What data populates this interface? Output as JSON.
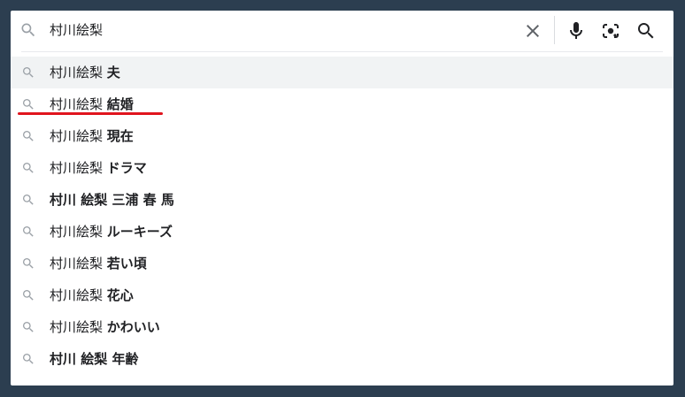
{
  "search": {
    "query": "村川絵梨",
    "icon": "search-icon"
  },
  "controls": {
    "clear_icon": "close-icon",
    "voice_icon": "microphone-icon",
    "lens_icon": "camera-lens-icon",
    "search_icon": "search-icon"
  },
  "suggestions": [
    {
      "prefix": "村川絵梨 ",
      "suffix": "夫"
    },
    {
      "prefix": "村川絵梨 ",
      "suffix": "結婚"
    },
    {
      "prefix": "村川絵梨 ",
      "suffix": "現在"
    },
    {
      "prefix": "村川絵梨 ",
      "suffix": "ドラマ"
    },
    {
      "prefix": "",
      "suffix": "村川 絵梨 三浦 春 馬"
    },
    {
      "prefix": "村川絵梨 ",
      "suffix": "ルーキーズ"
    },
    {
      "prefix": "村川絵梨 ",
      "suffix": "若い頃"
    },
    {
      "prefix": "村川絵梨 ",
      "suffix": "花心"
    },
    {
      "prefix": "村川絵梨 ",
      "suffix": "かわいい"
    },
    {
      "prefix": "",
      "suffix": "村川 絵梨 年齢"
    }
  ],
  "colors": {
    "highlight_underline": "#e0141e",
    "active_row": "#f1f3f4",
    "backdrop": "#2c3e50"
  }
}
